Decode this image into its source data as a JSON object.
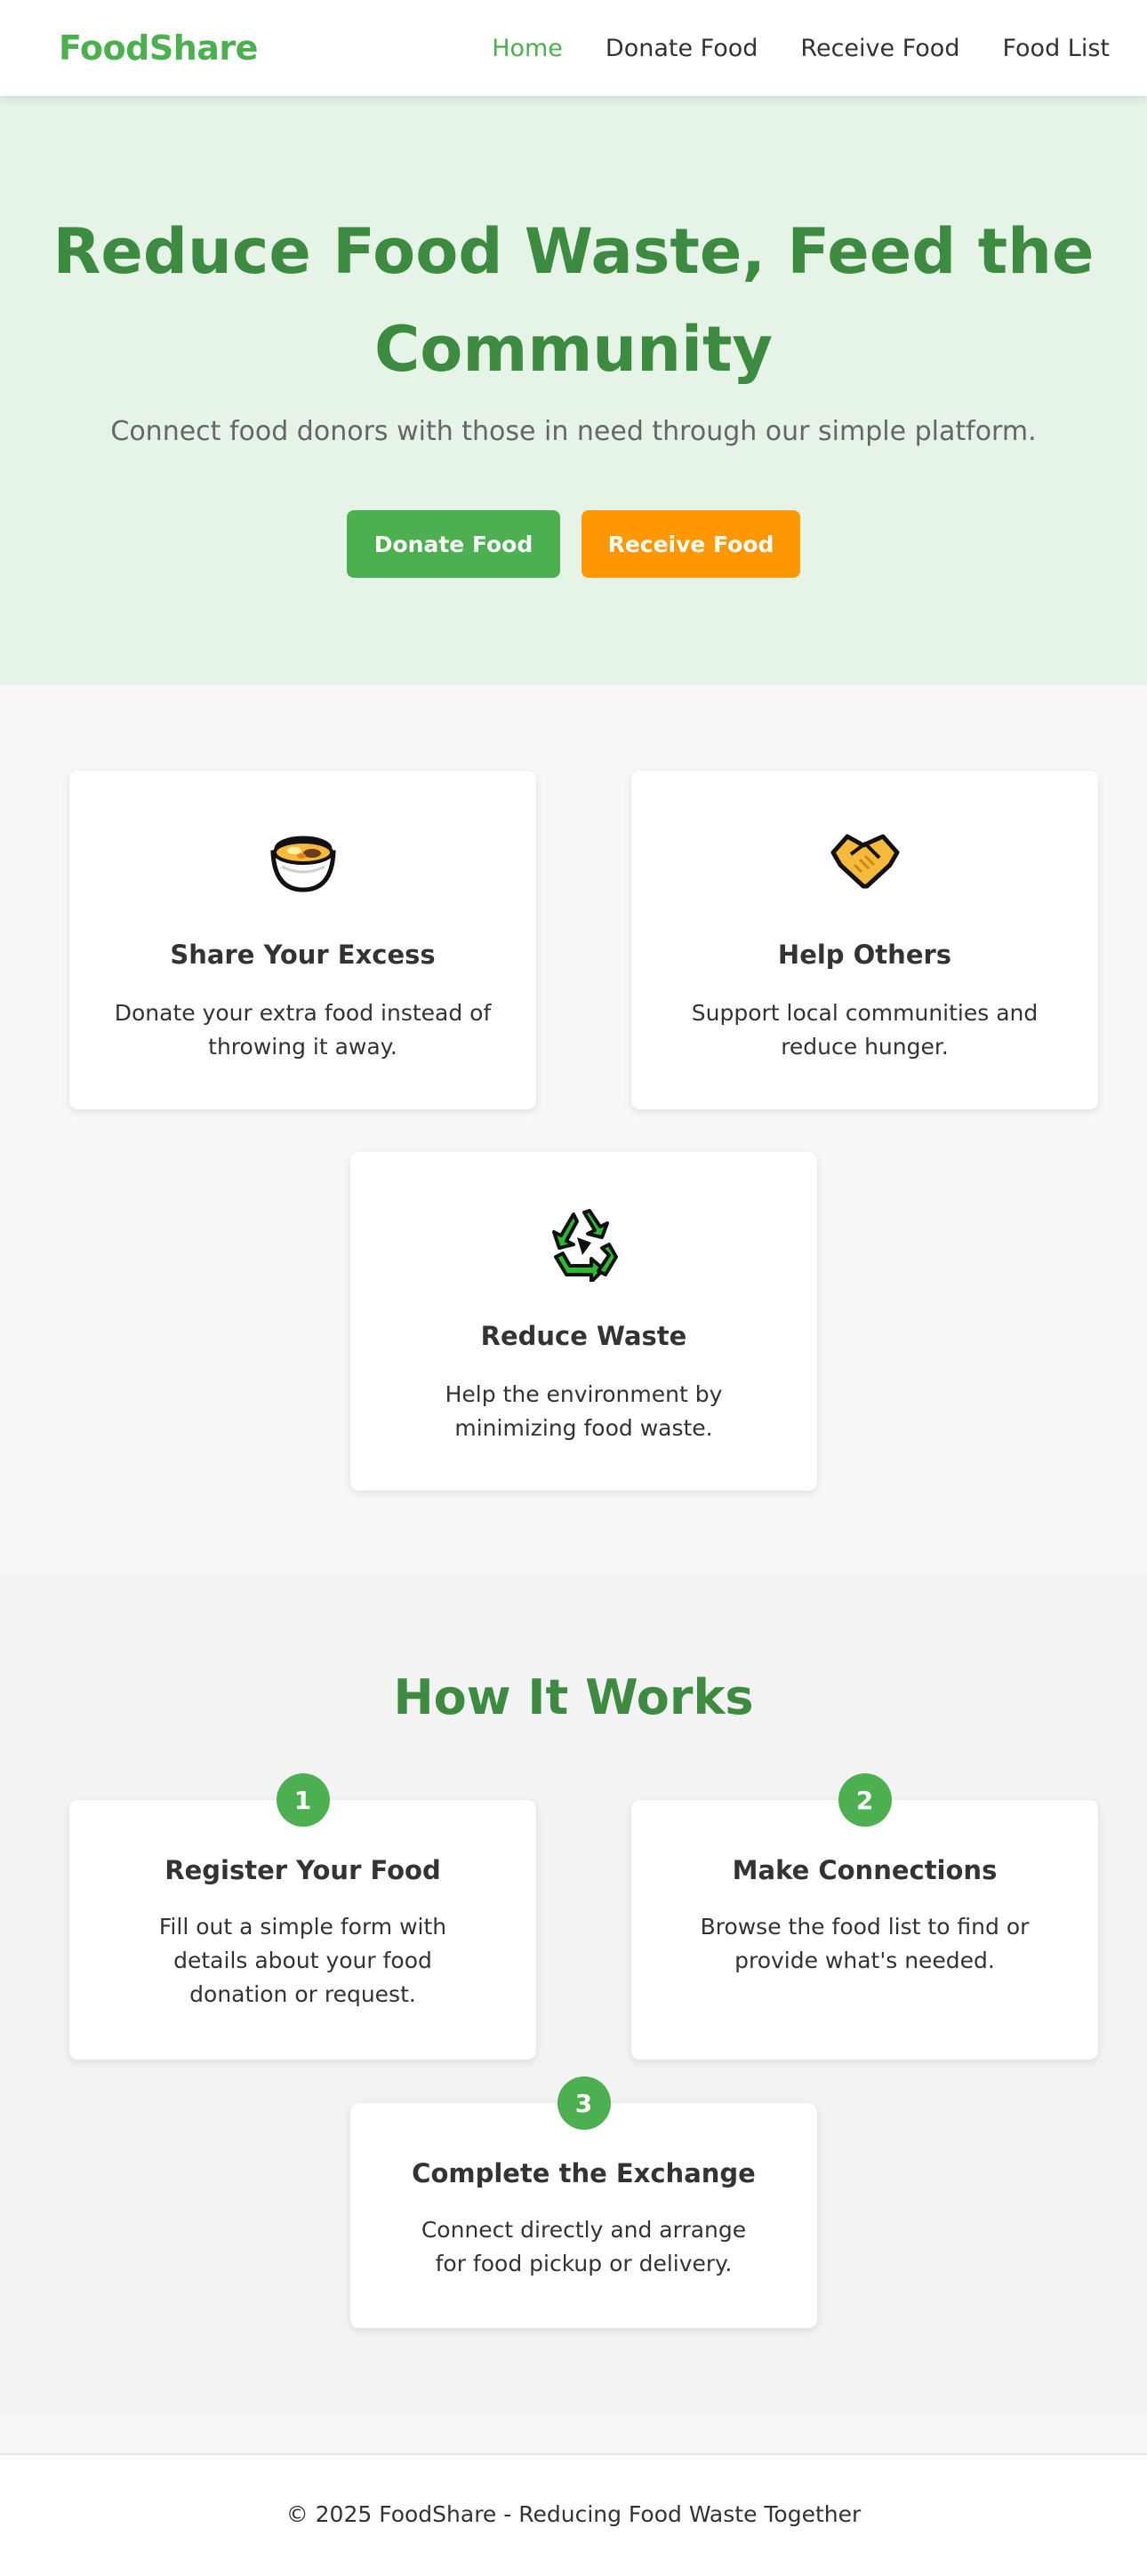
{
  "nav": {
    "brand": "FoodShare",
    "links": [
      {
        "label": "Home",
        "active": true
      },
      {
        "label": "Donate Food",
        "active": false
      },
      {
        "label": "Receive Food",
        "active": false
      },
      {
        "label": "Food List",
        "active": false
      }
    ]
  },
  "hero": {
    "title_line1": "Reduce Food Waste, Feed the",
    "title_line2": "Community",
    "subtitle": "Connect food donors with those in need through our simple platform.",
    "donate_button": "Donate Food",
    "receive_button": "Receive Food"
  },
  "features": [
    {
      "icon": "food-bowl-icon",
      "title": "Share Your Excess",
      "text": "Donate your extra food instead of throwing it away."
    },
    {
      "icon": "handshake-icon",
      "title": "Help Others",
      "text": "Support local communities and reduce hunger."
    },
    {
      "icon": "recycle-icon",
      "title": "Reduce Waste",
      "text": "Help the environment by minimizing food waste."
    }
  ],
  "how": {
    "title": "How It Works",
    "steps": [
      {
        "number": "1",
        "title": "Register Your Food",
        "text": "Fill out a simple form with details about your food donation or request."
      },
      {
        "number": "2",
        "title": "Make Connections",
        "text": "Browse the food list to find or provide what's needed."
      },
      {
        "number": "3",
        "title": "Complete the Exchange",
        "text": "Connect directly and arrange for food pickup or delivery."
      }
    ]
  },
  "footer": {
    "text": "© 2025 FoodShare - Reducing Food Waste Together"
  },
  "colors": {
    "brand_green": "#4caf50",
    "dark_green": "#3d8b40",
    "orange": "#ff9800",
    "hero_bg": "#e6f3e7"
  }
}
